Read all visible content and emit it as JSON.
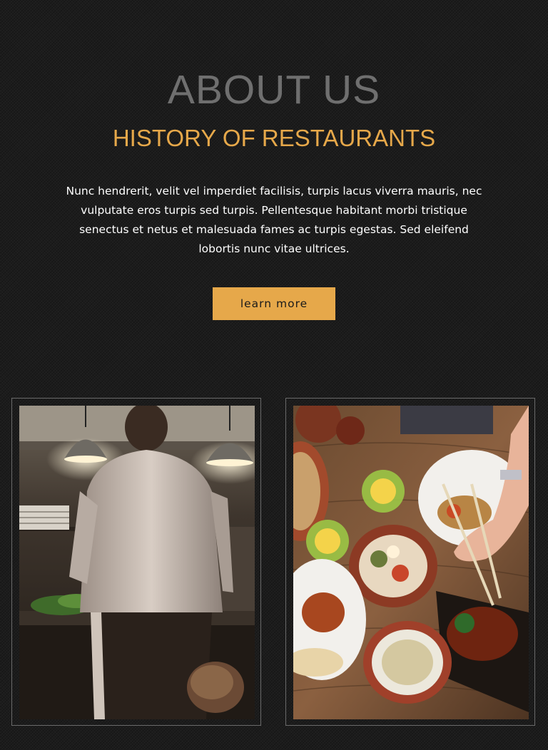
{
  "about": {
    "title": "ABOUT US",
    "subtitle": "HISTORY OF RESTAURANTS",
    "body": "Nunc hendrerit, velit vel imperdiet facilisis, turpis lacus viverra mauris, nec vulputate eros turpis sed turpis. Pellentesque habitant morbi tristique senectus et netus et malesuada fames ac turpis egestas. Sed eleifend lobortis nunc vitae ultrices.",
    "button_label": "learn more"
  },
  "gallery": {
    "images": [
      {
        "subject": "chef-in-kitchen"
      },
      {
        "subject": "dishes-on-table"
      }
    ]
  },
  "colors": {
    "background": "#1c1c1c",
    "title": "#6f6f6f",
    "accent": "#e6a84a",
    "text": "#ffffff",
    "frame_border": "#6a6a6a"
  }
}
